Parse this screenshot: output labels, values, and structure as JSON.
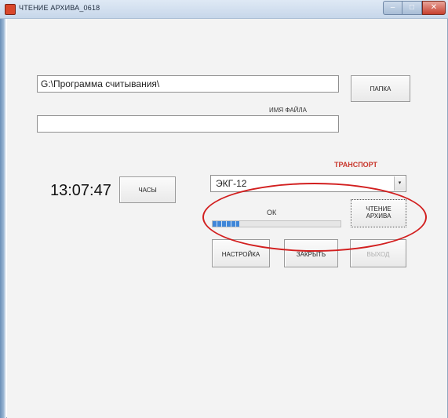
{
  "window": {
    "title": "ЧТЕНИЕ АРХИВА_0618",
    "min_glyph": "–",
    "max_glyph": "□",
    "close_glyph": "✕"
  },
  "path_field": {
    "value": "G:\\Программа считывания\\"
  },
  "folder_button": {
    "label": "ПАПКА"
  },
  "filename": {
    "label": "ИМЯ ФАЙЛА",
    "value": ""
  },
  "transport": {
    "label": "ТРАНСПОРТ",
    "selected": "ЭКГ-12",
    "arrow": "▾"
  },
  "clock": {
    "time": "13:07:47",
    "button_label": "ЧАСЫ"
  },
  "status": {
    "text": "ОК",
    "progress_percent": 21
  },
  "read_button": {
    "line1": "ЧТЕНИЕ",
    "line2": "АРХИВА"
  },
  "buttons": {
    "settings": "НАСТРОЙКА",
    "close": "ЗАКРЫТЬ",
    "exit": "ВЫХОД"
  },
  "colors": {
    "accent_red": "#c8362b",
    "progress_blue": "#3f86d8",
    "highlight": "#d21f1f"
  },
  "icons": {
    "app": "app-icon",
    "dropdown": "chevron-down-icon"
  }
}
